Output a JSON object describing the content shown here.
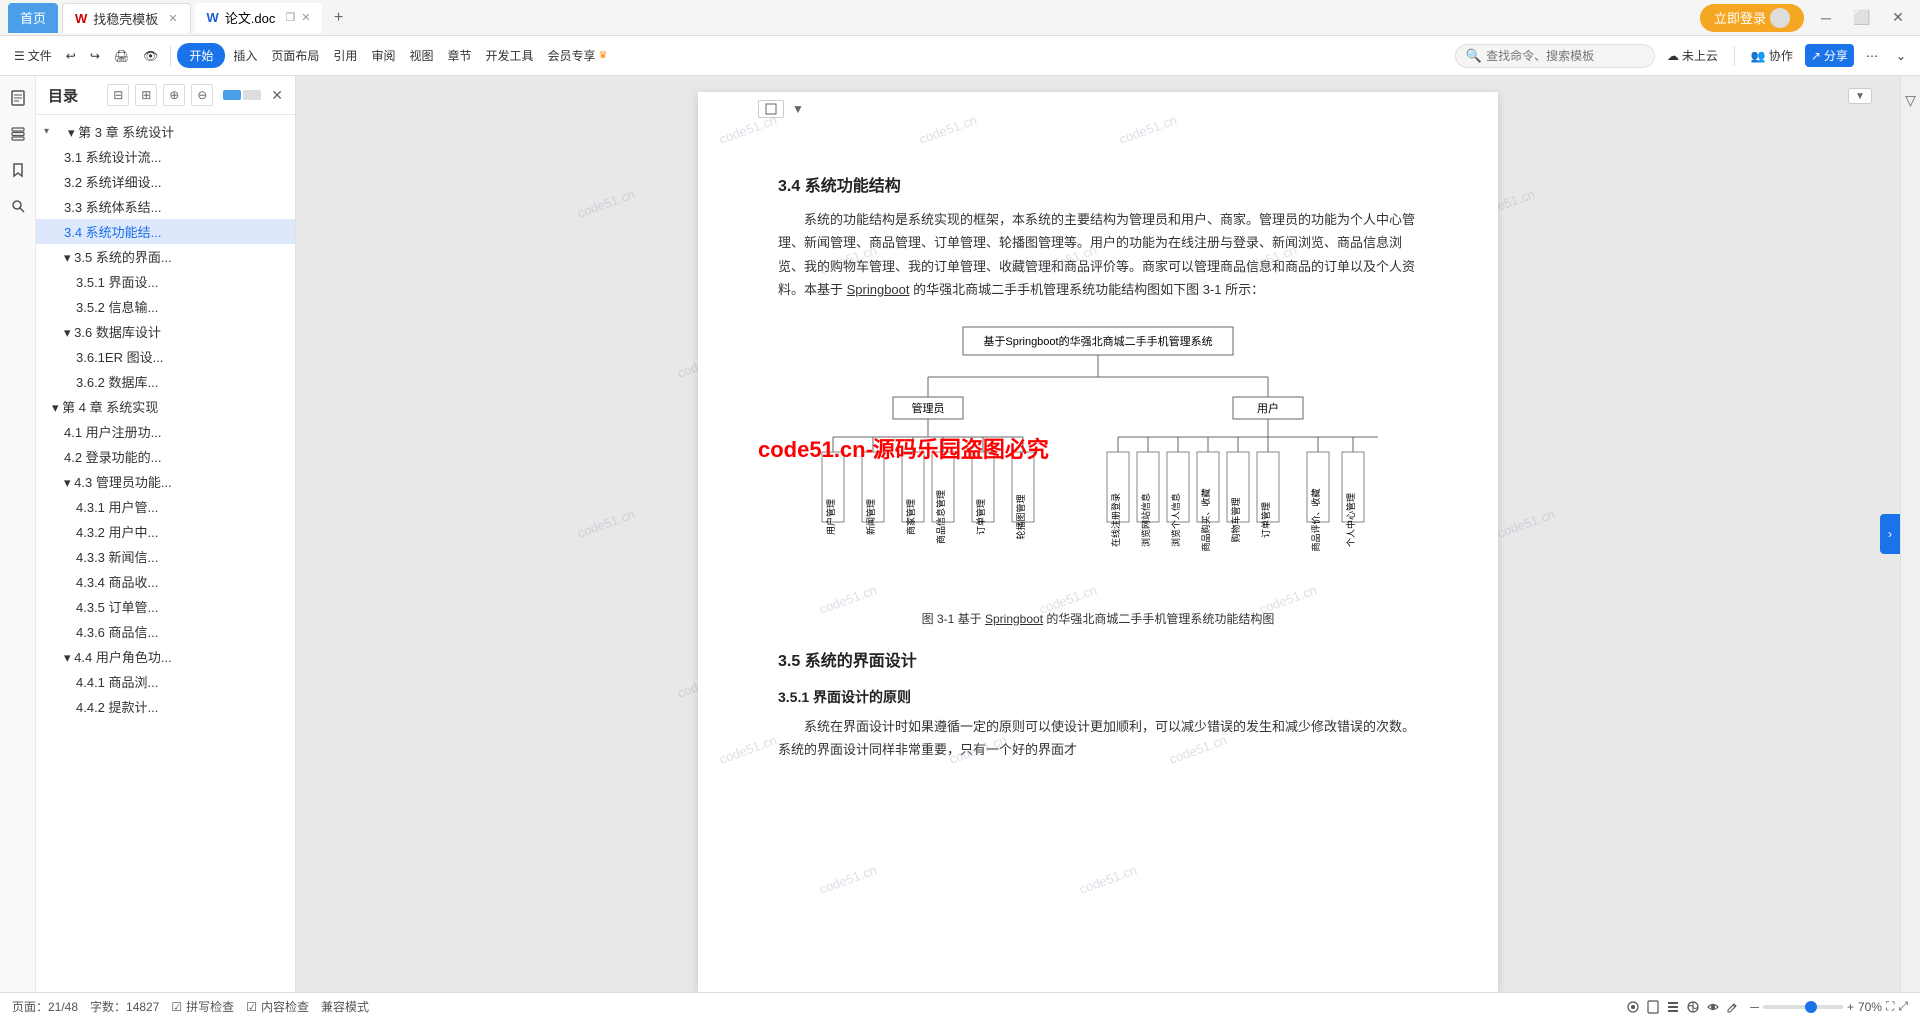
{
  "titlebar": {
    "tabs": [
      {
        "id": "home",
        "label": "首页",
        "type": "home"
      },
      {
        "id": "wps",
        "label": "找稳壳模板",
        "icon": "wps",
        "type": "wps"
      },
      {
        "id": "doc",
        "label": "论文.doc",
        "icon": "word",
        "type": "word",
        "active": true
      }
    ],
    "add_tab_label": "+",
    "login_btn": "立即登录",
    "minimize": "─",
    "restore": "❐",
    "close": "✕"
  },
  "toolbar": {
    "file": "文件",
    "start": "开始",
    "insert": "插入",
    "layout": "页面布局",
    "reference": "引用",
    "review": "审阅",
    "view": "视图",
    "chapter": "章节",
    "dev": "开发工具",
    "member": "会员专享",
    "search_placeholder": "查找命令、搜索模板",
    "cloud": "未上云",
    "collab": "协作",
    "share": "分享",
    "more": "⋯"
  },
  "sidebar": {
    "title": "目录",
    "close": "✕",
    "items": [
      {
        "id": "ch3",
        "text": "第 3 章  系统设计",
        "level": 1,
        "indent": "indent1",
        "toggle": "▾"
      },
      {
        "id": "3.1",
        "text": "3.1 系统设计流...",
        "level": 2,
        "indent": "indent2"
      },
      {
        "id": "3.2",
        "text": "3.2 系统详细设...",
        "level": 2,
        "indent": "indent2"
      },
      {
        "id": "3.3",
        "text": "3.3 系统体系结...",
        "level": 2,
        "indent": "indent2"
      },
      {
        "id": "3.4",
        "text": "3.4 系统功能结...",
        "level": 2,
        "indent": "indent2",
        "active": true
      },
      {
        "id": "3.5",
        "text": "3.5 系统的界面...",
        "level": 2,
        "indent": "indent2",
        "toggle": "▾"
      },
      {
        "id": "3.5.1",
        "text": "3.5.1 界面设...",
        "level": 3,
        "indent": "indent3"
      },
      {
        "id": "3.5.2",
        "text": "3.5.2 信息输...",
        "level": 3,
        "indent": "indent3"
      },
      {
        "id": "3.6",
        "text": "3.6 数据库设计",
        "level": 2,
        "indent": "indent2",
        "toggle": "▾"
      },
      {
        "id": "3.6.1",
        "text": "3.6.1ER 图设...",
        "level": 3,
        "indent": "indent3"
      },
      {
        "id": "3.6.2",
        "text": "3.6.2 数据库...",
        "level": 3,
        "indent": "indent3"
      },
      {
        "id": "ch4",
        "text": "第 4 章  系统实现",
        "level": 1,
        "indent": "indent1",
        "toggle": "▾"
      },
      {
        "id": "4.1",
        "text": "4.1 用户注册功...",
        "level": 2,
        "indent": "indent2"
      },
      {
        "id": "4.2",
        "text": "4.2 登录功能的...",
        "level": 2,
        "indent": "indent2"
      },
      {
        "id": "4.3",
        "text": "4.3 管理员功能...",
        "level": 2,
        "indent": "indent2",
        "toggle": "▾"
      },
      {
        "id": "4.3.1",
        "text": "4.3.1 用户管...",
        "level": 3,
        "indent": "indent3"
      },
      {
        "id": "4.3.2",
        "text": "4.3.2 用户中...",
        "level": 3,
        "indent": "indent3"
      },
      {
        "id": "4.3.3",
        "text": "4.3.3 新闻信...",
        "level": 3,
        "indent": "indent3"
      },
      {
        "id": "4.3.4",
        "text": "4.3.4 商品收...",
        "level": 3,
        "indent": "indent3"
      },
      {
        "id": "4.3.5",
        "text": "4.3.5 订单管...",
        "level": 3,
        "indent": "indent3"
      },
      {
        "id": "4.3.6",
        "text": "4.3.6 商品信...",
        "level": 3,
        "indent": "indent3"
      },
      {
        "id": "4.4",
        "text": "4.4 用户角色功...",
        "level": 2,
        "indent": "indent2",
        "toggle": "▾"
      },
      {
        "id": "4.4.1",
        "text": "4.4.1 商品浏...",
        "level": 3,
        "indent": "indent3"
      },
      {
        "id": "4.4.2",
        "text": "4.4.2 提款计...",
        "level": 3,
        "indent": "indent3"
      }
    ]
  },
  "document": {
    "section_title": "3.4 系统功能结构",
    "para1": "系统的功能结构是系统实现的框架，本系统的主要结构为管理员和用户、商家。管理员的功能为个人中心管理、新闻管理、商品管理、订单管理、轮播图管理等。用户的功能为在线注册与登录、新闻浏览、商品信息浏览、我的购物车管理、我的订单管理、收藏管理和商品评价等。商家可以管理商品信息和商品的订单以及个人资料。本基于 Springboot 的华强北商城二手手机管理系统功能结构图如下图 3-1 所示：",
    "diagram_title": "基于Springboot的华强北商城二手手机管理系统",
    "diagram_root_admin": "管理员",
    "diagram_root_user": "用户",
    "diagram_nodes_admin": [
      "用户管理",
      "新闻管理",
      "商家管理",
      "商品信息管理",
      "订单管理",
      "轮播图管理"
    ],
    "diagram_nodes_user": [
      "在线注册登录",
      "浏览网站信息",
      "浏览个人信息",
      "商品购买、收藏",
      "购物车管理",
      "订单管理",
      "商品评价、收藏",
      "个人中心管理"
    ],
    "diagram_caption": "图 3-1 基于 Springboot 的华强北商城二手手机管理系统功能结构图",
    "section2_title": "3.5 系统的界面设计",
    "subsection2_title": "3.5.1 界面设计的原则",
    "para2": "系统在界面设计时如果遵循一定的原则可以使设计更加顺利，可以减少错误的发生和减少修改错误的次数。系统的界面设计同样非常重要，只有一个好的界面才",
    "watermark": "code51.cn",
    "red_watermark": "code51.cn-源码乐园盗图必究",
    "springboot_underline": "Springboot"
  },
  "statusbar": {
    "page_info": "页面：21/48",
    "word_count": "字数：14827",
    "spell_check": "☑ 拼写检查",
    "content_check": "☑ 内容检查",
    "compat_mode": "兼容模式",
    "view_icons": [
      "阅读",
      "文档",
      "列表",
      "网页",
      "护眼",
      "编辑"
    ],
    "zoom": "70%",
    "zoom_minus": "─",
    "zoom_plus": "+"
  }
}
